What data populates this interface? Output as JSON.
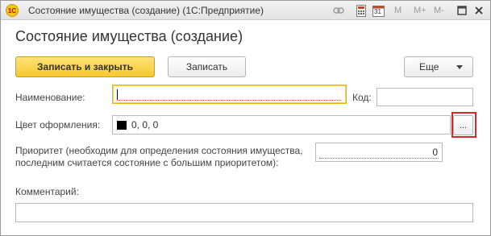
{
  "window": {
    "title": "Состояние имущества (создание)  (1С:Предприятие)",
    "app_icon_text": "1С",
    "toolbar": {
      "m": "M",
      "m_plus": "M+",
      "m_minus": "M-",
      "calendar_day": "31"
    }
  },
  "form": {
    "title": "Состояние имущества (создание)",
    "buttons": {
      "save_close": "Записать и закрыть",
      "save": "Записать",
      "more": "Еще"
    },
    "fields": {
      "name_label": "Наименование:",
      "name_value": "",
      "code_label": "Код:",
      "code_value": "",
      "color_label": "Цвет оформления:",
      "color_value": "0, 0, 0",
      "color_swatch": "#000000",
      "picker_label": "...",
      "priority_label_line1": "Приоритет (необходим для определения состояния имущества,",
      "priority_label_line2": "последним считается состояние с большим приоритетом):",
      "priority_value": "0",
      "comment_label": "Комментарий:",
      "comment_value": ""
    }
  },
  "colors": {
    "accent": "#f5c92c",
    "highlight": "#d9262b"
  }
}
